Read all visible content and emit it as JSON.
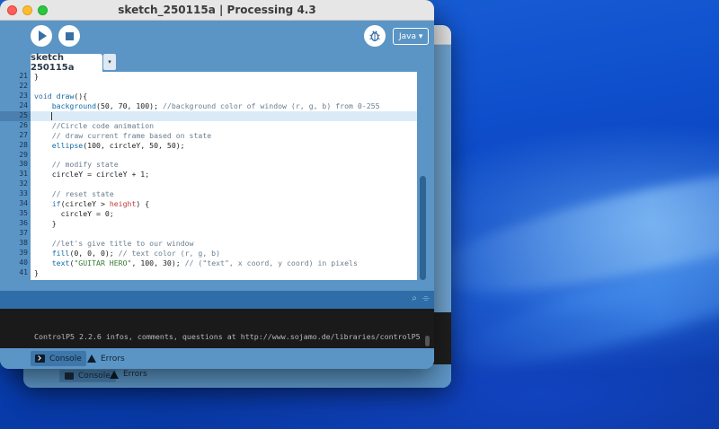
{
  "window": {
    "title": "sketch_250115a | Processing 4.3"
  },
  "toolbar": {
    "mode_label": "Java ▾"
  },
  "tabs": [
    {
      "label": "sketch 250115a",
      "menu_glyph": "▾"
    }
  ],
  "editor": {
    "current_line": 25,
    "lines": [
      {
        "num": "21",
        "text": "}"
      },
      {
        "num": "22",
        "text": ""
      },
      {
        "num": "23",
        "text": "void draw(){"
      },
      {
        "num": "24",
        "text": "    background(50, 70, 100); //background color of window (r, g, b) from 0-255"
      },
      {
        "num": "25",
        "text": "    "
      },
      {
        "num": "26",
        "text": "    //Circle code animation"
      },
      {
        "num": "27",
        "text": "    // draw current frame based on state"
      },
      {
        "num": "28",
        "text": "    ellipse(100, circleY, 50, 50);"
      },
      {
        "num": "29",
        "text": ""
      },
      {
        "num": "30",
        "text": "    // modify state"
      },
      {
        "num": "31",
        "text": "    circleY = circleY + 1;"
      },
      {
        "num": "32",
        "text": ""
      },
      {
        "num": "33",
        "text": "    // reset state"
      },
      {
        "num": "34",
        "text": "    if(circleY > height) {"
      },
      {
        "num": "35",
        "text": "      circleY = 0;"
      },
      {
        "num": "36",
        "text": "    }"
      },
      {
        "num": "37",
        "text": ""
      },
      {
        "num": "38",
        "text": "    //let's give title to our window"
      },
      {
        "num": "39",
        "text": "    fill(0, 0, 0); // text color (r, g, b)"
      },
      {
        "num": "40",
        "text": "    text(\"GUITAR HERO\", 100, 30); // (\"text\", x coord, y coord) in pixels"
      },
      {
        "num": "41",
        "text": "}"
      }
    ]
  },
  "console": {
    "message": "ControlP5 2.2.6 infos, comments, questions at http://www.sojamo.de/libraries/controlP5"
  },
  "bottom_tabs": {
    "console_label": "Console",
    "errors_label": "Errors"
  },
  "background_window": {
    "console_label": "Console",
    "errors_label": "Errors"
  },
  "colors": {
    "theme_blue": "#5b95c5",
    "console_bg": "#1a1a1a",
    "keyword": "#2b6ea8"
  }
}
